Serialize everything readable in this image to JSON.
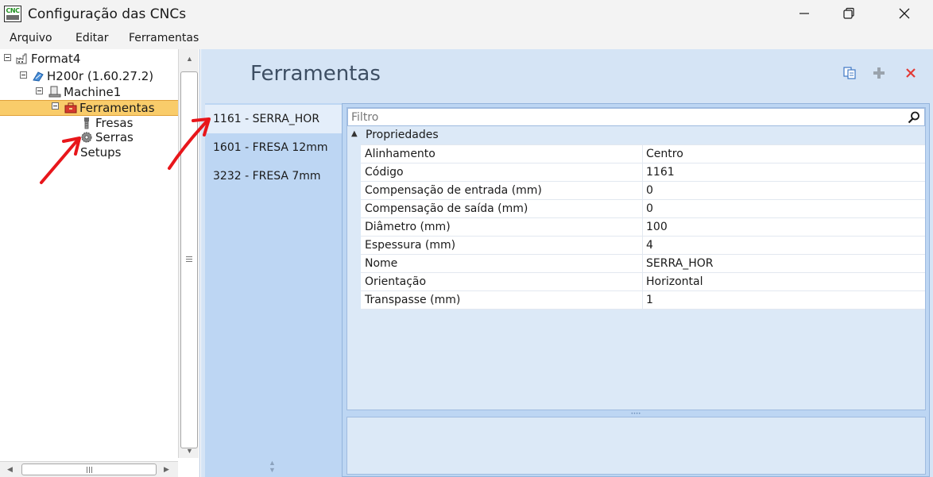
{
  "window": {
    "title": "Configuração das CNCs",
    "icon_text": "CNC"
  },
  "menu": {
    "items": [
      "Arquivo",
      "Editar",
      "Ferramentas"
    ]
  },
  "tree": {
    "nodes": [
      {
        "label": "Format4",
        "icon": "factory-icon"
      },
      {
        "label": "H200r (1.60.27.2)",
        "icon": "machine-icon"
      },
      {
        "label": "Machine1",
        "icon": "computer-icon"
      },
      {
        "label": "Ferramentas",
        "icon": "toolbox-icon",
        "selected": true
      },
      {
        "label": "Fresas",
        "icon": "drill-bit-icon"
      },
      {
        "label": "Serras",
        "icon": "saw-blade-icon"
      },
      {
        "label": "Setups",
        "icon": ""
      }
    ]
  },
  "main": {
    "title": "Ferramentas",
    "toolbar_icons": [
      "copy-icon",
      "add-icon",
      "delete-icon"
    ]
  },
  "tools": [
    {
      "label": "1161 - SERRA_HOR",
      "active": true
    },
    {
      "label": "1601 - FRESA 12mm",
      "active": false
    },
    {
      "label": "3232 - FRESA 7mm",
      "active": false
    }
  ],
  "properties": {
    "filter_placeholder": "Filtro",
    "category": "Propriedades",
    "rows": [
      {
        "name": "Alinhamento",
        "value": "Centro"
      },
      {
        "name": "Código",
        "value": "1161"
      },
      {
        "name": "Compensação de entrada (mm)",
        "value": "0"
      },
      {
        "name": "Compensação de saída (mm)",
        "value": "0"
      },
      {
        "name": "Diâmetro (mm)",
        "value": "100"
      },
      {
        "name": "Espessura (mm)",
        "value": "4"
      },
      {
        "name": "Nome",
        "value": "SERRA_HOR"
      },
      {
        "name": "Orientação",
        "value": "Horizontal"
      },
      {
        "name": "Transpasse (mm)",
        "value": "1"
      }
    ]
  },
  "colors": {
    "selection": "#f9cc6a",
    "panel_bg": "#d5e4f5",
    "list_bg": "#bdd6f3",
    "annotation_arrow": "#e8161b"
  }
}
